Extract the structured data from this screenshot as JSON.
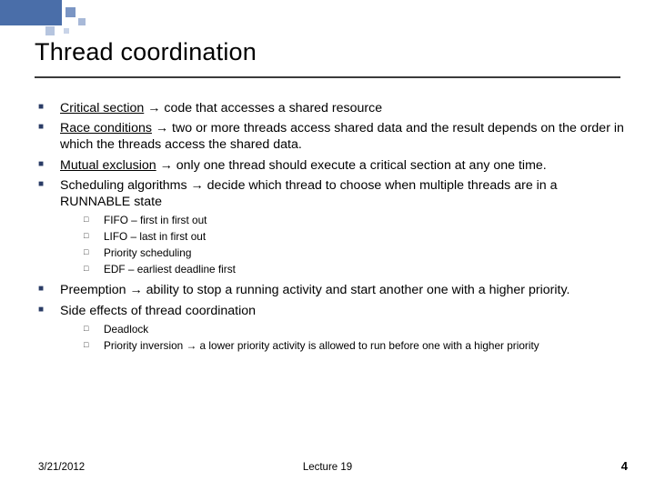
{
  "title": "Thread coordination",
  "bullets": [
    {
      "term": "Critical section",
      "arrow": "→",
      "desc": "code that accesses a shared resource"
    },
    {
      "term": "Race conditions",
      "arrow": "→",
      "desc": "two or more threads access shared data and the result depends on the order in which the threads access the shared data."
    },
    {
      "term": "Mutual exclusion",
      "arrow": "→",
      "desc": "only one thread should execute a critical section at any one time."
    },
    {
      "term": "",
      "arrow": "",
      "desc": "Scheduling algorithms → decide which thread to choose when multiple threads are in a RUNNABLE state"
    }
  ],
  "sched_sub": [
    "FIFO – first in first out",
    "LIFO – last in first out",
    "Priority scheduling",
    "EDF – earliest deadline first"
  ],
  "bullets2": [
    {
      "term": "",
      "arrow": "",
      "desc": "Preemption → ability to stop a running activity and start another one with a higher priority."
    },
    {
      "term": "",
      "arrow": "",
      "desc": "Side effects of thread coordination"
    }
  ],
  "side_sub": [
    "Deadlock",
    "Priority inversion → a lower priority activity is allowed to run before one with a higher priority"
  ],
  "footer": {
    "date": "3/21/2012",
    "center": "Lecture 19",
    "page": "4"
  }
}
